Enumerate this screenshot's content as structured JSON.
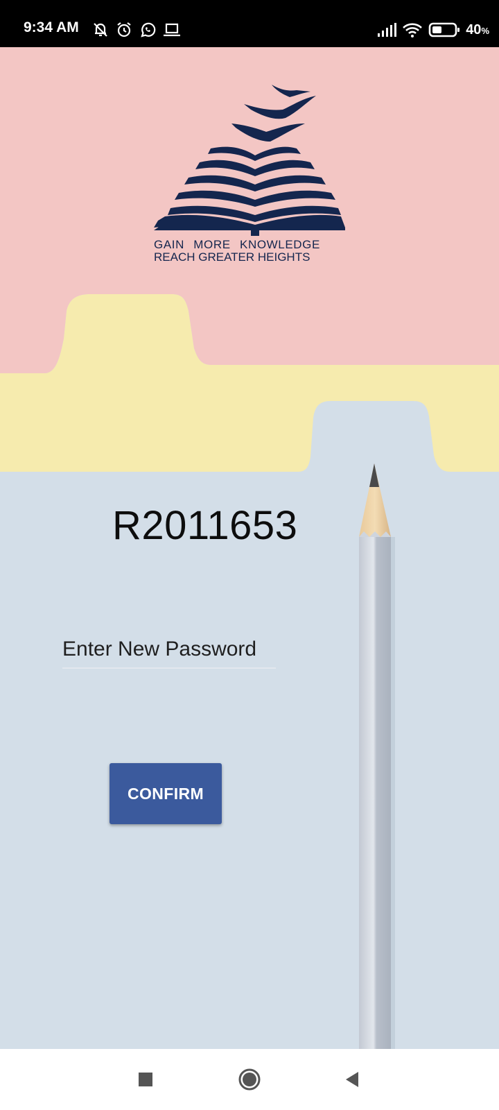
{
  "status_bar": {
    "time": "9:34 AM",
    "battery_percent": "40",
    "battery_unit": "%",
    "battery_level": 0.4,
    "left_icons": [
      "muted-bell-icon",
      "alarm-icon",
      "whatsapp-icon",
      "laptop-icon"
    ],
    "right_icons": [
      "signal-icon",
      "wifi-icon",
      "battery-icon"
    ]
  },
  "logo": {
    "tagline_line1": "GAIN MORE KNOWLEDGE",
    "tagline_line2": "REACH GREATER HEIGHTS",
    "color": "#14264e"
  },
  "main": {
    "user_id": "R2011653",
    "password_placeholder": "Enter New Password",
    "password_value": "",
    "confirm_label": "CONFIRM"
  },
  "colors": {
    "pink": "#f3c6c4",
    "yellow": "#f6ebae",
    "blue": "#cfdce6",
    "button": "#3b5a9d"
  },
  "nav_bar": {
    "buttons": [
      "recents-icon",
      "home-icon",
      "back-icon"
    ]
  }
}
